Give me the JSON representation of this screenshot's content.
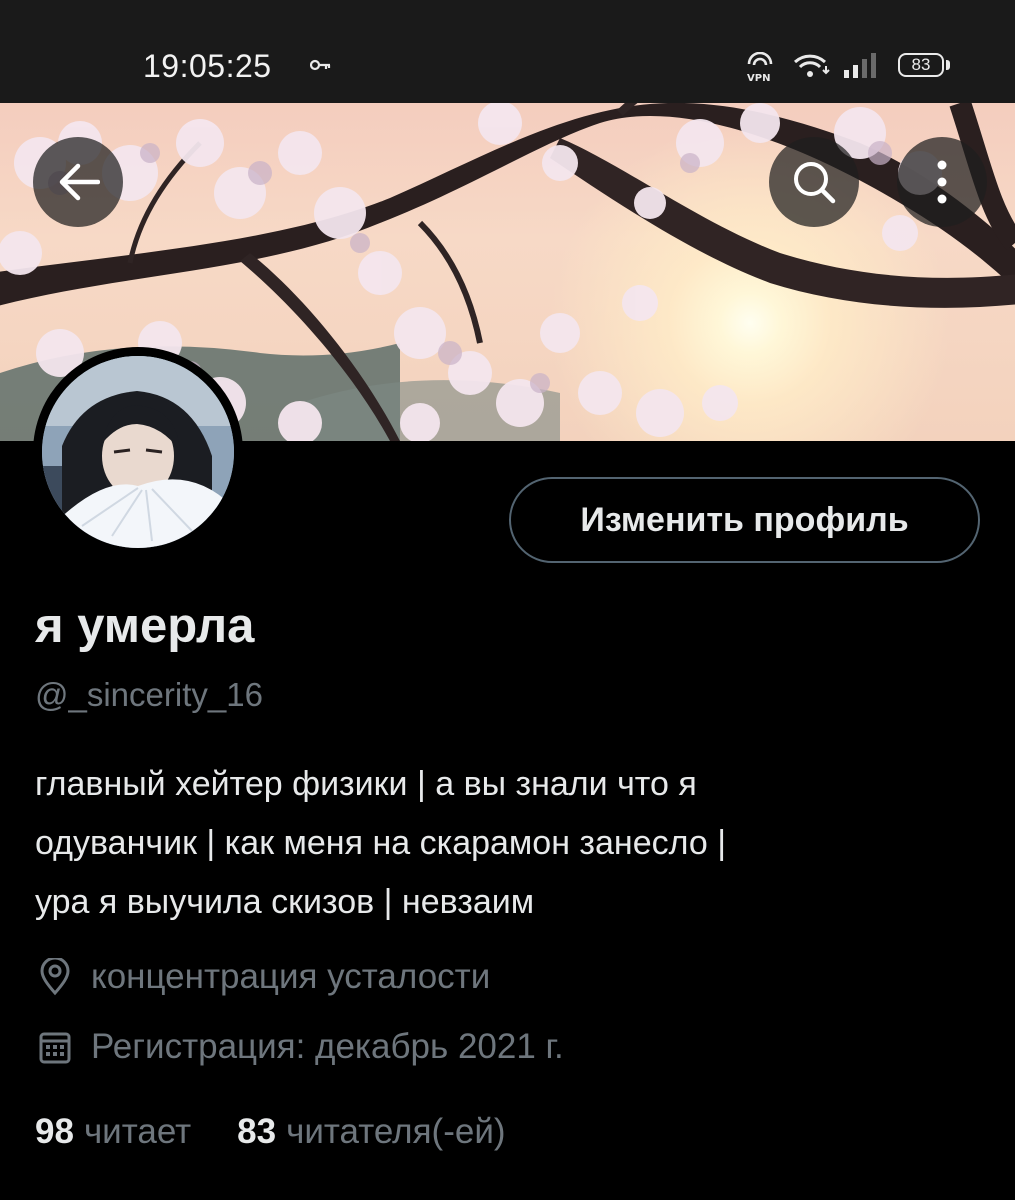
{
  "status_bar": {
    "time": "19:05:25",
    "battery": "83",
    "icons": [
      "key-icon",
      "vpn-icon",
      "wifi-icon",
      "signal-icon",
      "battery-icon"
    ]
  },
  "header_buttons": {
    "back_icon": "arrow-left-icon",
    "search_icon": "search-icon",
    "more_icon": "more-vertical-icon"
  },
  "profile": {
    "edit_button_label": "Изменить профиль",
    "display_name": "я умерла",
    "handle": "@_sincerity_16",
    "bio_lines": [
      "главный хейтер физики | а вы знали что я",
      "одуванчик | как меня на скарамон занесло |",
      "ура я выучила скизов | невзаим"
    ],
    "location": "концентрация усталости",
    "joined": "Регистрация: декабрь 2021 г.",
    "following_count": "98",
    "following_label": "читает",
    "followers_count": "83",
    "followers_label": "читателя(-ей)"
  },
  "colors": {
    "background": "#000000",
    "text_primary": "#e7e9ea",
    "text_secondary": "#6e767d",
    "button_border": "#536471"
  }
}
